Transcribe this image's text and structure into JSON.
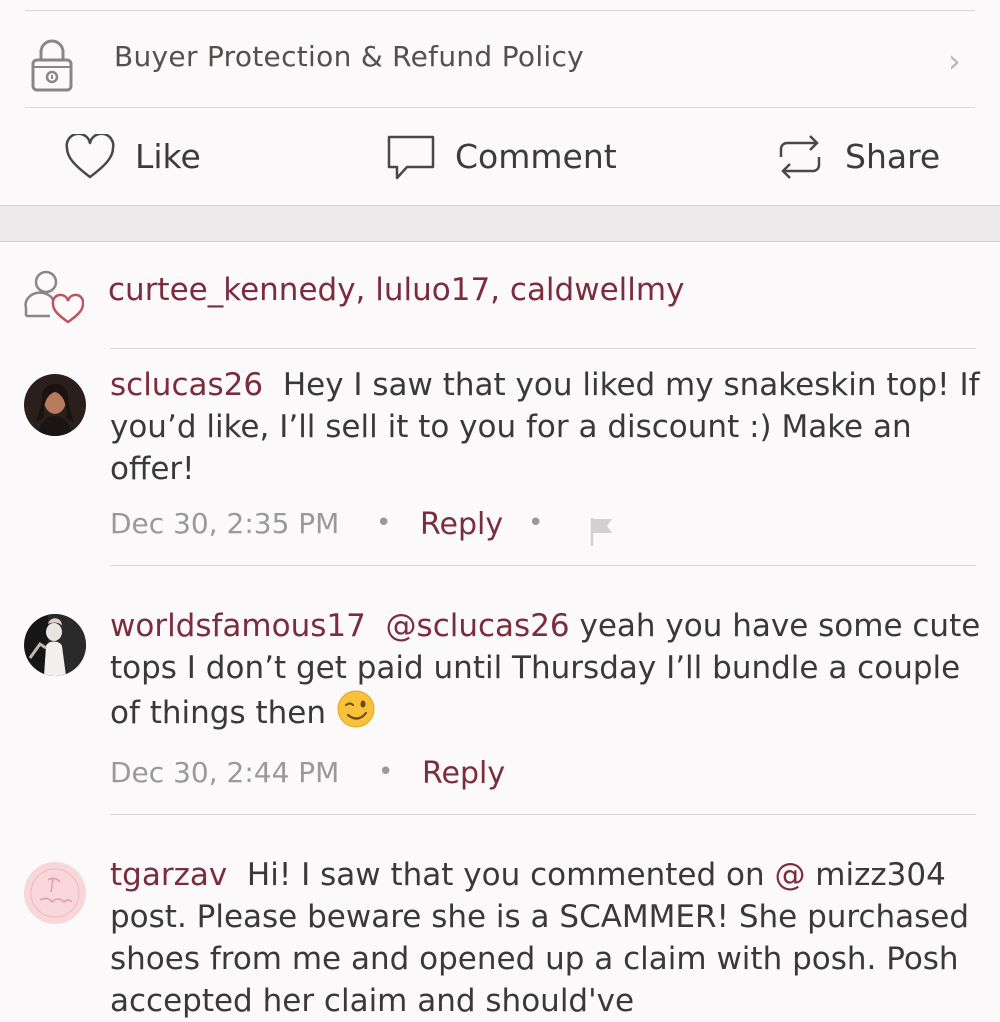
{
  "protection": {
    "label": "Buyer Protection & Refund Policy"
  },
  "actions": {
    "like": "Like",
    "comment": "Comment",
    "share": "Share"
  },
  "likers": {
    "text": "curtee_kennedy, luluo17, caldwellmy"
  },
  "comments": [
    {
      "username": "sclucas26",
      "body": "Hey I saw that you liked my snakeskin top! If you’d like, I’ll sell it to you for a discount :) Make an offer!",
      "timestamp": "Dec 30, 2:35 PM",
      "reply": "Reply"
    },
    {
      "username": "worldsfamous17",
      "mention": "@sclucas26",
      "body": "yeah you have some cute tops I don’t get paid until Thursday I’ll bundle a couple of things then",
      "timestamp": "Dec 30, 2:44 PM",
      "reply": "Reply"
    },
    {
      "username": "tgarzav",
      "body_before": "Hi! I saw that you commented on ",
      "mention": "@",
      "body_after": " mizz304 post. Please beware she is a SCAMMER! She purchased shoes from me and opened up a claim with posh. Posh accepted her claim and should've"
    }
  ],
  "colors": {
    "accent": "#7b2c3f",
    "text": "#3a3839",
    "muted": "#9c9899",
    "band": "#edebec"
  },
  "icons": [
    "lock-icon",
    "chevron-right-icon",
    "heart-icon",
    "comment-bubble-icon",
    "share-arrows-icon",
    "people-heart-icon",
    "flag-icon",
    "wink-emoji-icon"
  ]
}
